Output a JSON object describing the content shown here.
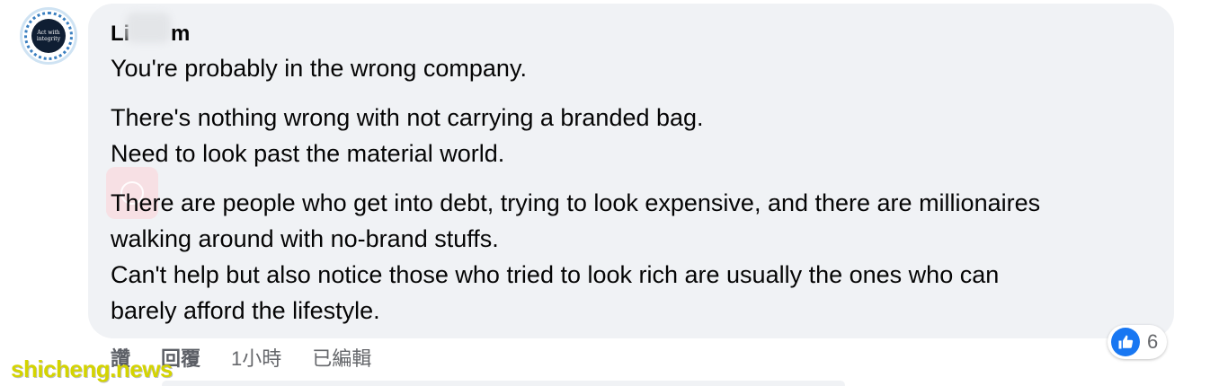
{
  "comment": {
    "author_visible_start": "Li",
    "author_visible_end": "m",
    "paragraph1": "You're probably in the wrong company.",
    "paragraph2_line1": "There's nothing wrong with not carrying a branded bag.",
    "paragraph2_line2": "Need to look past the material world.",
    "paragraph3_line1": "There are people who get into debt, trying to look expensive, and there are millionaires",
    "paragraph3_line2": "walking around with no-brand stuffs.",
    "paragraph3_line3": "Can't help but also notice those who tried to look rich are usually the ones who can",
    "paragraph3_line4": "barely afford the lifestyle."
  },
  "avatar": {
    "text": "Act with integrity"
  },
  "actions": {
    "like_label": "讚",
    "reply_label": "回覆",
    "time": "1小時",
    "edited": "已編輯"
  },
  "reactions": {
    "icon": "thumbs-up-icon",
    "count": "6",
    "color": "#1877f2"
  },
  "watermark": {
    "text": "shicheng.news"
  }
}
